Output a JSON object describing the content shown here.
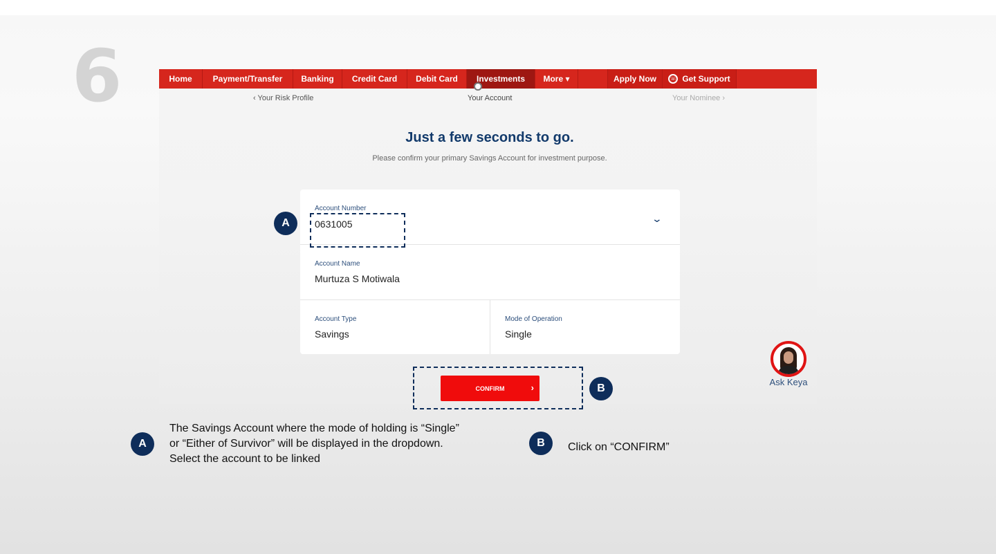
{
  "step_number": "6",
  "navbar": {
    "items": [
      "Home",
      "Payment/Transfer",
      "Banking",
      "Credit Card",
      "Debit Card",
      "Investments",
      "More ▾"
    ],
    "active": "Investments",
    "apply_now": "Apply Now",
    "get_support": "Get Support"
  },
  "steps": {
    "prev": "‹ Your Risk Profile",
    "current": "Your Account",
    "next": "Your Nominee ›"
  },
  "heading": "Just a few seconds to go.",
  "subheading": "Please confirm your primary Savings Account for investment purpose.",
  "form": {
    "account_number_label": "Account Number",
    "account_number_value": "0631005",
    "account_name_label": "Account Name",
    "account_name_value": "Murtuza S Motiwala",
    "account_type_label": "Account Type",
    "account_type_value": "Savings",
    "mode_label": "Mode of Operation",
    "mode_value": "Single"
  },
  "confirm_label": "CONFIRM",
  "ask_keya": "Ask Keya",
  "badges": {
    "a": "A",
    "b": "B"
  },
  "instructions": {
    "a": "The Savings Account where the mode of holding is “Single” or “Either of Survivor” will be displayed in the dropdown. Select the account to be linked",
    "b": "Click on “CONFIRM”"
  },
  "colors": {
    "nav_red": "#d6261d",
    "nav_active": "#9e1712",
    "confirm_red": "#f00c0c",
    "badge_navy": "#0e2d5a",
    "heading_blue": "#123a6b"
  }
}
